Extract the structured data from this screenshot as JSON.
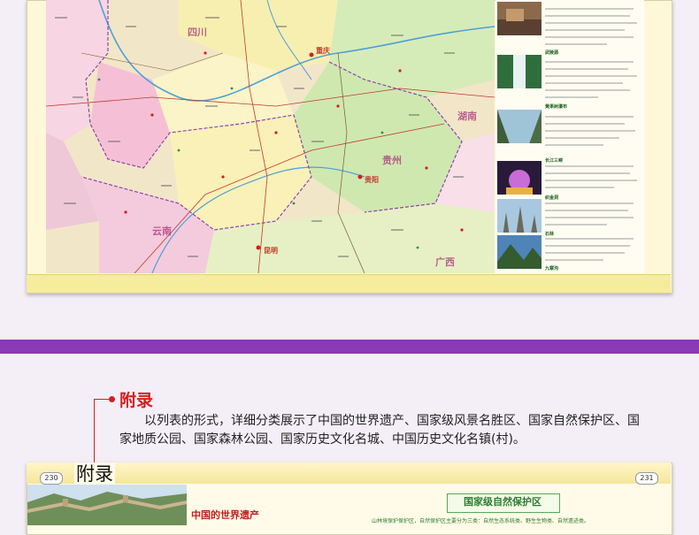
{
  "annotation": {
    "title": "附录",
    "description": "以列表的形式，详细分类展示了中国的世界遗产、国家级风景名胜区、国家自然保护区、国家地质公园、国家森林公园、国家历史文化名城、中国历史文化名镇(村)。"
  },
  "bottom_book": {
    "left_page_number": "230",
    "right_page_number": "231",
    "section_label": "附录",
    "left_heading": "中国的世界遗产",
    "right_heading": "国家级自然保护区",
    "right_text": "山林境保护保护区，自然保护区主要分为三类：自然生态系统类、野生生物类、自然遗迹类。"
  },
  "side_panel": {
    "spots": [
      "武陵源",
      "黄果树瀑布",
      "长江三峡",
      "织金洞",
      "石林",
      "九寨沟"
    ]
  },
  "map": {
    "places": [
      "重庆",
      "贵阳",
      "昆明",
      "贵州",
      "云南",
      "四川",
      "湖南",
      "广西"
    ]
  },
  "colors": {
    "band": "#8a3ab7",
    "accent_red": "#d32020",
    "page": "#fff8d8",
    "nature_green": "#2e7d32"
  }
}
